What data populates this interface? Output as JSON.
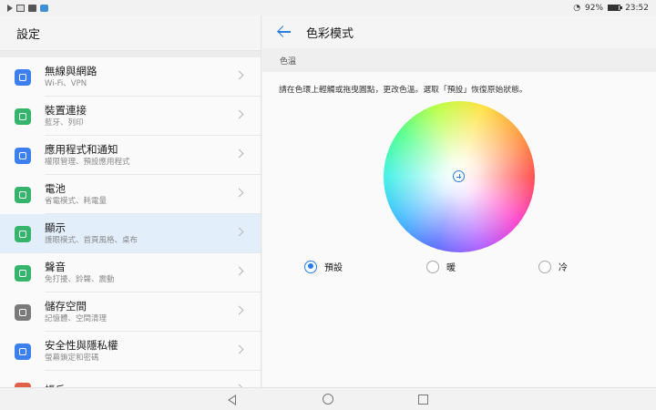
{
  "status_bar": {
    "battery_percent": "92%",
    "battery_level": 0.92,
    "time": "23:52",
    "left_icons": [
      "play-icon",
      "image-icon",
      "message-icon",
      "app-icon"
    ]
  },
  "left_panel": {
    "title": "設定",
    "items": [
      {
        "title": "無線與網路",
        "subtitle": "Wi-Fi、VPN",
        "icon": "wifi-icon",
        "color": "#3b7ff0"
      },
      {
        "title": "裝置連接",
        "subtitle": "藍牙、列印",
        "icon": "device-connection-icon",
        "color": "#35b56b"
      },
      {
        "title": "應用程式和通知",
        "subtitle": "權限管理、預設應用程式",
        "icon": "apps-icon",
        "color": "#3b7ff0"
      },
      {
        "title": "電池",
        "subtitle": "省電模式、耗電量",
        "icon": "battery-icon",
        "color": "#35b56b"
      },
      {
        "title": "顯示",
        "subtitle": "護眼模式、首頁風格、桌布",
        "icon": "display-icon",
        "color": "#35b56b"
      },
      {
        "title": "聲音",
        "subtitle": "免打擾、鈴聲、震動",
        "icon": "sound-icon",
        "color": "#35b56b"
      },
      {
        "title": "儲存空間",
        "subtitle": "記憶體、空間清理",
        "icon": "storage-icon",
        "color": "#7a7a7a"
      },
      {
        "title": "安全性與隱私權",
        "subtitle": "螢幕鎖定和密碼",
        "icon": "security-shield-icon",
        "color": "#3b7ff0"
      },
      {
        "title": "帳戶",
        "subtitle": "",
        "icon": "account-icon",
        "color": "#e0604a"
      }
    ],
    "active_index": 4
  },
  "right_panel": {
    "title": "色彩模式",
    "section_label": "色溫",
    "description": "請在色環上輕觸或拖曳圓點，更改色溫。選取「預設」恢復原始狀態。",
    "options": [
      {
        "label": "預設",
        "checked": true
      },
      {
        "label": "暖",
        "checked": false
      },
      {
        "label": "冷",
        "checked": false
      }
    ],
    "accent_color": "#2a7de1"
  },
  "nav_bar": {
    "icons": [
      "nav-back-icon",
      "nav-home-icon",
      "nav-recents-icon"
    ]
  }
}
